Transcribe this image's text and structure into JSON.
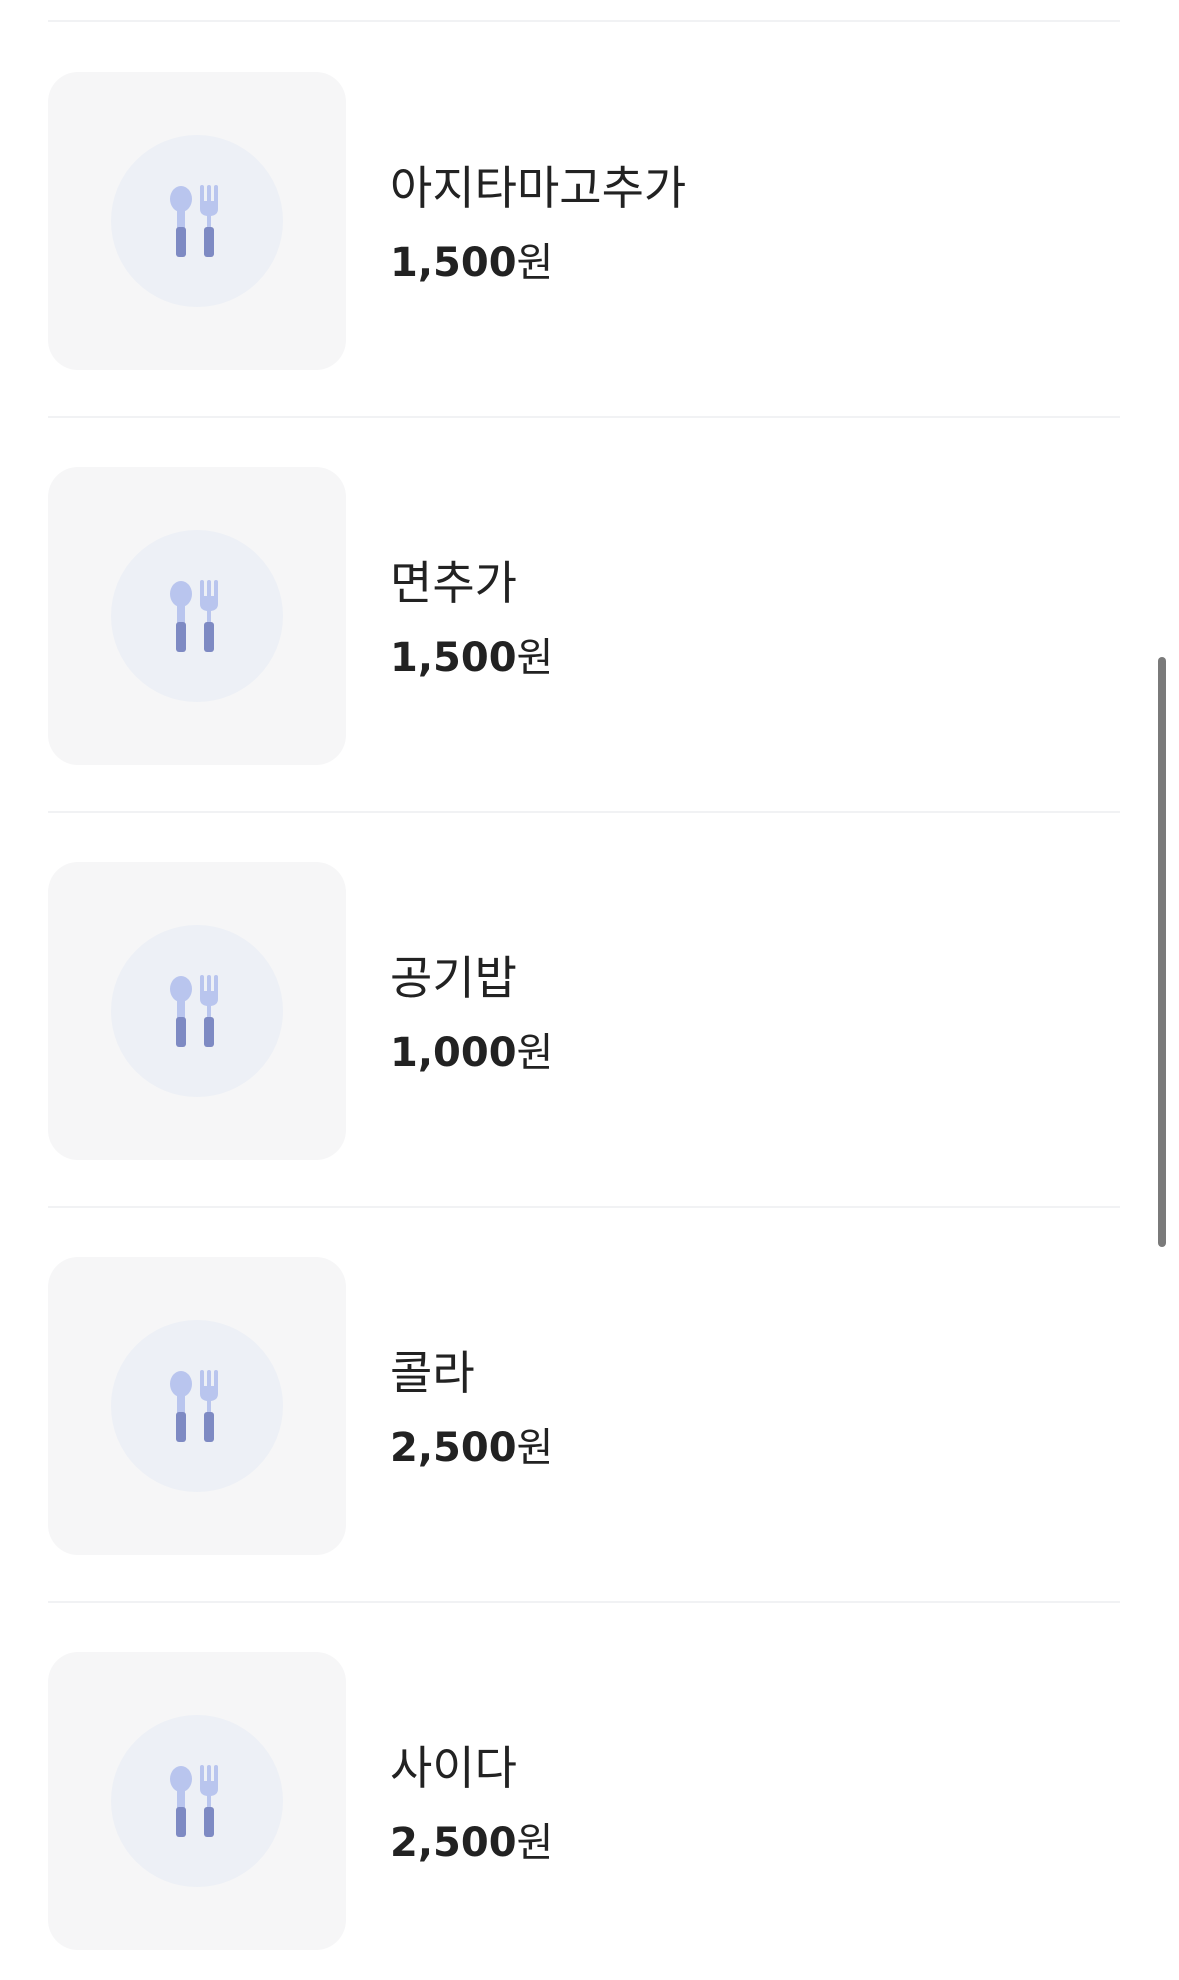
{
  "menu": {
    "items": [
      {
        "name": "아지타마고추가",
        "price": "1,500",
        "unit": "원",
        "icon": "utensils-icon"
      },
      {
        "name": "면추가",
        "price": "1,500",
        "unit": "원",
        "icon": "utensils-icon"
      },
      {
        "name": "공기밥",
        "price": "1,000",
        "unit": "원",
        "icon": "utensils-icon"
      },
      {
        "name": "콜라",
        "price": "2,500",
        "unit": "원",
        "icon": "utensils-icon"
      },
      {
        "name": "사이다",
        "price": "2,500",
        "unit": "원",
        "icon": "utensils-icon"
      }
    ]
  },
  "colors": {
    "thumb_bg": "#f6f6f7",
    "icon_circle": "#edf0f6",
    "icon_light": "#b9c5ee",
    "icon_dark": "#7e8ac3"
  }
}
